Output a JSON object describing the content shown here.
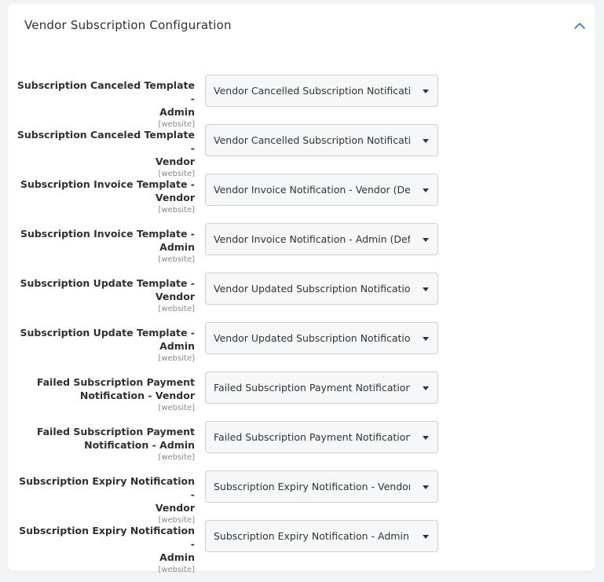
{
  "panel": {
    "title": "Vendor Subscription Configuration",
    "collapse_icon": "chevron-up-icon",
    "accent_color": "#1e64c8"
  },
  "scope_label": "[website]",
  "fields": [
    {
      "label_line1": "Subscription Canceled Template -",
      "label_line2": "Admin",
      "value": "Vendor Cancelled Subscription Notification"
    },
    {
      "label_line1": "Subscription Canceled Template -",
      "label_line2": "Vendor",
      "value": "Vendor Cancelled Subscription Notification"
    },
    {
      "label_line1": "Subscription Invoice Template -",
      "label_line2": "Vendor",
      "value": "Vendor Invoice Notification - Vendor (Defa"
    },
    {
      "label_line1": "Subscription Invoice Template -",
      "label_line2": "Admin",
      "value": "Vendor Invoice Notification - Admin (Defau"
    },
    {
      "label_line1": "Subscription Update Template -",
      "label_line2": "Vendor",
      "value": "Vendor Updated Subscription Notification"
    },
    {
      "label_line1": "Subscription Update Template -",
      "label_line2": "Admin",
      "value": "Vendor Updated Subscription Notification"
    },
    {
      "label_line1": "Failed Subscription Payment",
      "label_line2": "Notification - Vendor",
      "value": "Failed Subscription Payment Notification -"
    },
    {
      "label_line1": "Failed Subscription Payment",
      "label_line2": "Notification - Admin",
      "value": "Failed Subscription Payment Notification -"
    },
    {
      "label_line1": "Subscription Expiry Notification -",
      "label_line2": "Vendor",
      "value": "Subscription Expiry Notification - Vendor (I"
    },
    {
      "label_line1": "Subscription Expiry Notification -",
      "label_line2": "Admin",
      "value": "Subscription Expiry Notification - Admin (D"
    }
  ]
}
